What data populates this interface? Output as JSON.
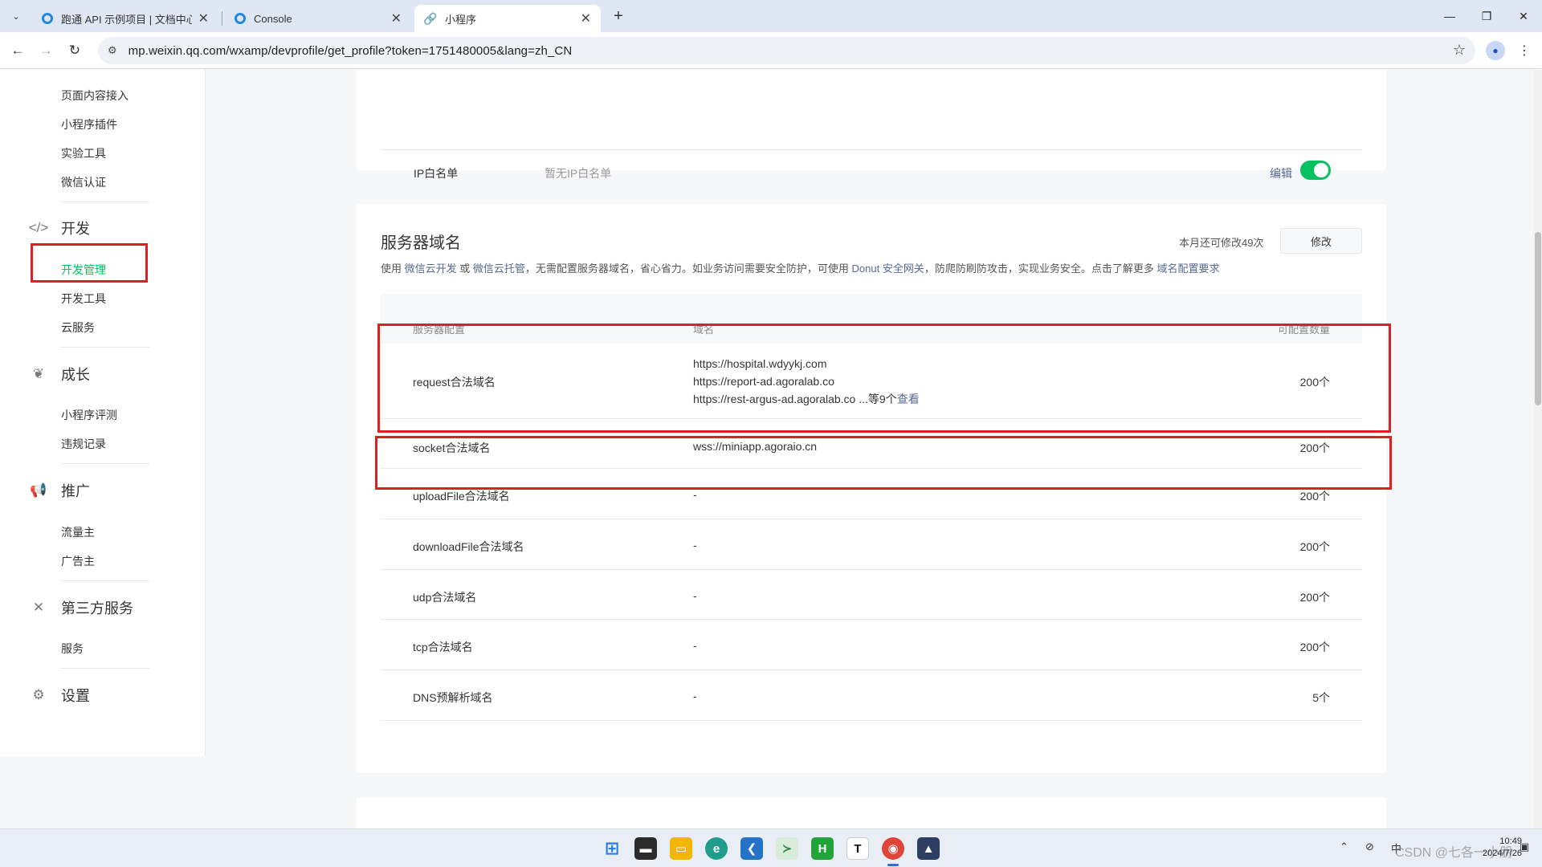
{
  "browser": {
    "tabs": [
      {
        "title": "跑通 API 示例项目 | 文档中心 |",
        "active": false
      },
      {
        "title": "Console",
        "active": false
      },
      {
        "title": "小程序",
        "active": true
      }
    ],
    "url": "mp.weixin.qq.com/wxamp/devprofile/get_profile?token=1751480005&lang=zh_CN",
    "window_buttons": {
      "minimize": "—",
      "restore": "❐",
      "close": "✕"
    }
  },
  "sidebar": {
    "top_items": [
      "页面内容接入",
      "小程序插件",
      "实验工具",
      "微信认证"
    ],
    "groups": [
      {
        "label": "开发",
        "icon": "code-icon",
        "items": [
          "开发管理",
          "开发工具",
          "云服务"
        ]
      },
      {
        "label": "成长",
        "icon": "sprout-icon",
        "items": [
          "小程序评测",
          "违规记录"
        ]
      },
      {
        "label": "推广",
        "icon": "megaphone-icon",
        "items": [
          "流量主",
          "广告主"
        ]
      },
      {
        "label": "第三方服务",
        "icon": "third-party-icon",
        "items": [
          "服务"
        ]
      },
      {
        "label": "设置",
        "icon": "gear-icon",
        "items": []
      }
    ],
    "active_item": "开发管理"
  },
  "ip_whitelist": {
    "label": "IP白名单",
    "value": "暂无IP白名单",
    "edit_label": "编辑",
    "enabled": true
  },
  "server_domains": {
    "title": "服务器域名",
    "quota_text": "本月还可修改49次",
    "modify_label": "修改",
    "desc": {
      "p1": "使用 ",
      "link1": "微信云开发",
      "p2": " 或 ",
      "link2": "微信云托管",
      "p3": "，无需配置服务器域名，省心省力。如业务访问需要安全防护，可使用 ",
      "link3": "Donut 安全网关",
      "p4": "，防爬防刷防攻击，实现业务安全。点击了解更多 ",
      "link4": "域名配置要求"
    },
    "columns": [
      "服务器配置",
      "域名",
      "可配置数量"
    ],
    "rows": [
      {
        "name": "request合法域名",
        "domains": [
          "https://hospital.wdyykj.com",
          "https://report-ad.agoralab.co",
          "https://rest-argus-ad.agoralab.co"
        ],
        "more": "...等9个",
        "view": "查看",
        "count": "200个"
      },
      {
        "name": "socket合法域名",
        "domains": [
          "wss://miniapp.agoraio.cn"
        ],
        "count": "200个"
      },
      {
        "name": "uploadFile合法域名",
        "domains": [
          "-"
        ],
        "count": "200个"
      },
      {
        "name": "downloadFile合法域名",
        "domains": [
          "-"
        ],
        "count": "200个"
      },
      {
        "name": "udp合法域名",
        "domains": [
          "-"
        ],
        "count": "200个"
      },
      {
        "name": "tcp合法域名",
        "domains": [
          "-"
        ],
        "count": "200个"
      },
      {
        "name": "DNS预解析域名",
        "domains": [
          "-"
        ],
        "count": "5个"
      }
    ]
  },
  "highlight_color": "#e02020",
  "accent_color": "#07c160",
  "link_color": "#576b95",
  "taskbar": {
    "apps": [
      "start-icon",
      "file-manager-icon",
      "folder-icon",
      "edge-icon",
      "vscode-icon",
      "wechat-devtools-icon",
      "hbuilder-icon",
      "typora-icon",
      "chrome-icon",
      "app-icon"
    ],
    "tray_ime": "中",
    "watermark": "CSDN @七各一小朋",
    "time": "10:49",
    "date": "2024/7/26"
  }
}
